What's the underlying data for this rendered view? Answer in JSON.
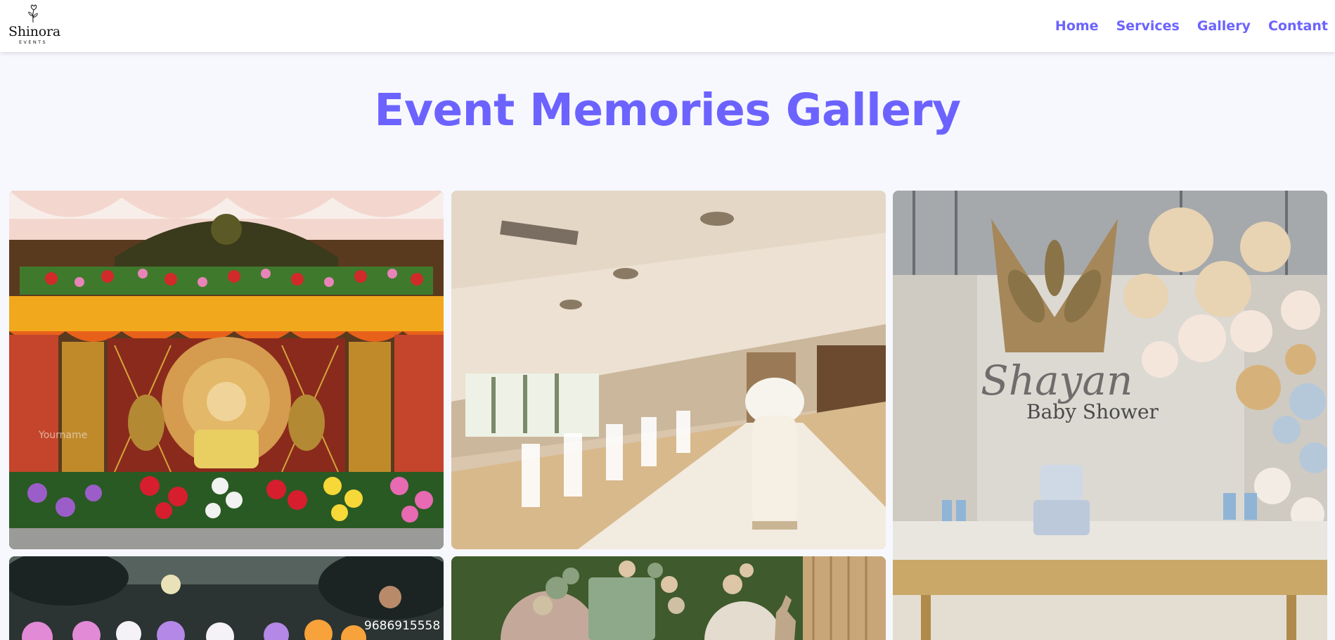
{
  "brand": {
    "name": "Shinora",
    "tagline": "EVENTS"
  },
  "nav": {
    "links": [
      "Home",
      "Services",
      "Gallery",
      "Contant"
    ]
  },
  "page": {
    "title": "Event Memories Gallery"
  },
  "gallery": {
    "items": [
      {
        "subject": "wedding-stage-decoration",
        "watermark": "Yourname"
      },
      {
        "subject": "banquet-hall-ceremony"
      },
      {
        "subject": "baby-shower-setup",
        "sign_script": "Shayan",
        "sign_text": "Baby Shower"
      },
      {
        "subject": "balloon-decoration-outdoor",
        "phone_text": "9686915558"
      },
      {
        "subject": "sage-balloon-backdrop"
      }
    ]
  },
  "colors": {
    "accent": "#6c63ff",
    "background": "#f7f8fd",
    "navbar": "#ffffff"
  }
}
